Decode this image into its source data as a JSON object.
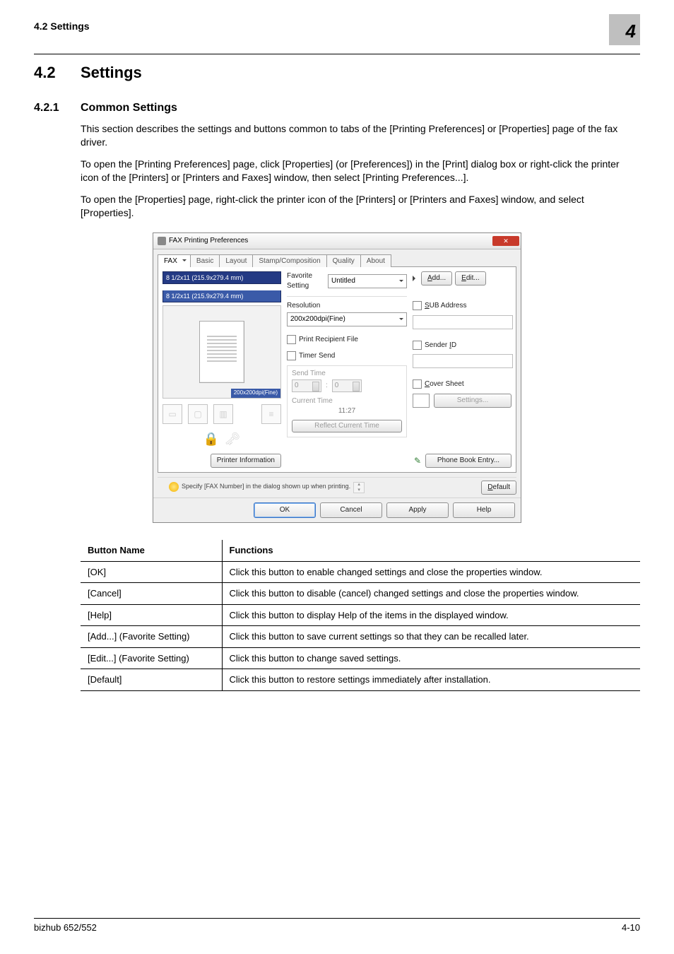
{
  "header": {
    "running": "4.2        Settings",
    "chapter_number": "4"
  },
  "section": {
    "number": "4.2",
    "title": "Settings"
  },
  "subsection": {
    "number": "4.2.1",
    "title": "Common Settings"
  },
  "paragraphs": {
    "p1": "This section describes the settings and buttons common to tabs of the [Printing Preferences] or [Properties] page of the fax driver.",
    "p2": "To open the [Printing Preferences] page, click [Properties] (or [Preferences]) in the [Print] dialog box or right-click the printer icon of the [Printers] or [Printers and Faxes] window, then select [Printing Preferences...].",
    "p3": "To open the [Properties] page, right-click the printer icon of the [Printers] or [Printers and Faxes] window, and select [Properties]."
  },
  "dialog": {
    "title": "FAX Printing Preferences",
    "close": "✕",
    "tabs": [
      "FAX",
      "Basic",
      "Layout",
      "Stamp/Composition",
      "Quality",
      "About"
    ],
    "preview": {
      "line1": "8 1/2x11 (215.9x279.4 mm)",
      "line2": "8 1/2x11 (215.9x279.4 mm)",
      "res_badge": "200x200dpi(Fine)"
    },
    "printer_info_btn": "Printer Information",
    "favorite_setting_label": "Favorite Setting",
    "favorite_setting_value": "Untitled",
    "add_btn_pre": "A",
    "add_btn_rest": "dd...",
    "edit_btn_pre": "E",
    "edit_btn_rest": "dit...",
    "resolution_label": "Resolution",
    "resolution_value": "200x200dpi(Fine)",
    "print_recipient_label": "Print Recipient File",
    "timer_send_label": "Timer Send",
    "send_time_label": "Send Time",
    "hour_value": "0",
    "minute_value": "0",
    "current_time_label": "Current Time",
    "current_time_value": "11:27",
    "reflect_btn": "Reflect Current Time",
    "sub_address_label": "SUB Address",
    "sub_address_prefix": "S",
    "sender_id_label": "Sender ",
    "sender_id_suffix": "ID",
    "sender_id_prefix_letter": "I",
    "cover_sheet_label": "Cover Sheet",
    "cover_sheet_prefix": "C",
    "settings_btn": "Settings...",
    "phone_book_btn": "Phone Book Entry...",
    "info_text": "Specify [FAX Number] in the dialog shown up when printing.",
    "default_btn_pre": "D",
    "default_btn_rest": "efault",
    "buttons": {
      "ok": "OK",
      "cancel": "Cancel",
      "apply": "Apply",
      "help": "Help"
    }
  },
  "table": {
    "headers": [
      "Button Name",
      "Functions"
    ],
    "rows": [
      {
        "name": "[OK]",
        "func": "Click this button to enable changed settings and close the properties window."
      },
      {
        "name": "[Cancel]",
        "func": "Click this button to disable (cancel) changed settings and close the properties window."
      },
      {
        "name": "[Help]",
        "func": "Click this button to display Help of the items in the displayed window."
      },
      {
        "name": "[Add...] (Favorite Setting)",
        "func": "Click this button to save current settings so that they can be recalled later."
      },
      {
        "name": "[Edit...] (Favorite Setting)",
        "func": "Click this button to change saved settings."
      },
      {
        "name": "[Default]",
        "func": "Click this button to restore settings immediately after installation."
      }
    ]
  },
  "footer": {
    "left": "bizhub 652/552",
    "right": "4-10"
  }
}
